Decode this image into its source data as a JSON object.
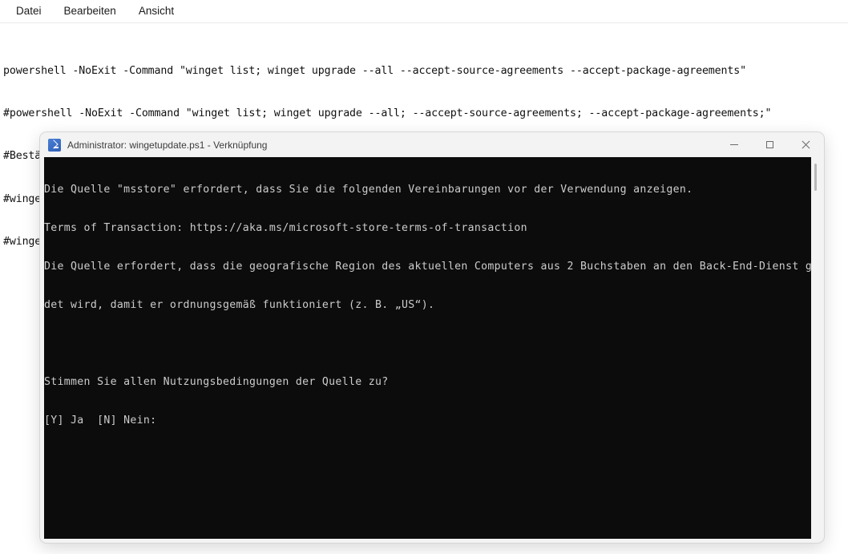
{
  "editor": {
    "menu": [
      {
        "label": "Datei"
      },
      {
        "label": "Bearbeiten"
      },
      {
        "label": "Ansicht"
      }
    ],
    "lines": [
      "powershell -NoExit -Command \"winget list; winget upgrade --all --accept-source-agreements --accept-package-agreements\"",
      "#powershell -NoExit -Command \"winget list; winget upgrade --all; --accept-source-agreements; --accept-package-agreements;\"",
      "#Bestätigt automatisch die Datenschutzbestimmungen",
      "#winget --accept-source-agreements",
      "#winget --accept-package-agreements"
    ]
  },
  "console": {
    "title": "Administrator: wingetupdate.ps1 - Verknüpfung",
    "icon": "powershell-icon",
    "window_controls": {
      "minimize": "minimize-icon",
      "maximize": "maximize-icon",
      "close": "close-icon"
    },
    "lines": [
      "Die Quelle \"msstore\" erfordert, dass Sie die folgenden Vereinbarungen vor der Verwendung anzeigen.",
      "Terms of Transaction: https://aka.ms/microsoft-store-terms-of-transaction",
      "Die Quelle erfordert, dass die geografische Region des aktuellen Computers aus 2 Buchstaben an den Back-End-Dienst gesen",
      "det wird, damit er ordnungsgemäß funktioniert (z. B. „US“).",
      "",
      "Stimmen Sie allen Nutzungsbedingungen der Quelle zu?",
      "[Y] Ja  [N] Nein:"
    ]
  },
  "colors": {
    "console_background": "#0c0c0c",
    "console_text": "#cccccc",
    "titlebar_background": "#f3f3f3",
    "app_background": "#ffffff",
    "powershell_blue": "#2f5fb8"
  }
}
